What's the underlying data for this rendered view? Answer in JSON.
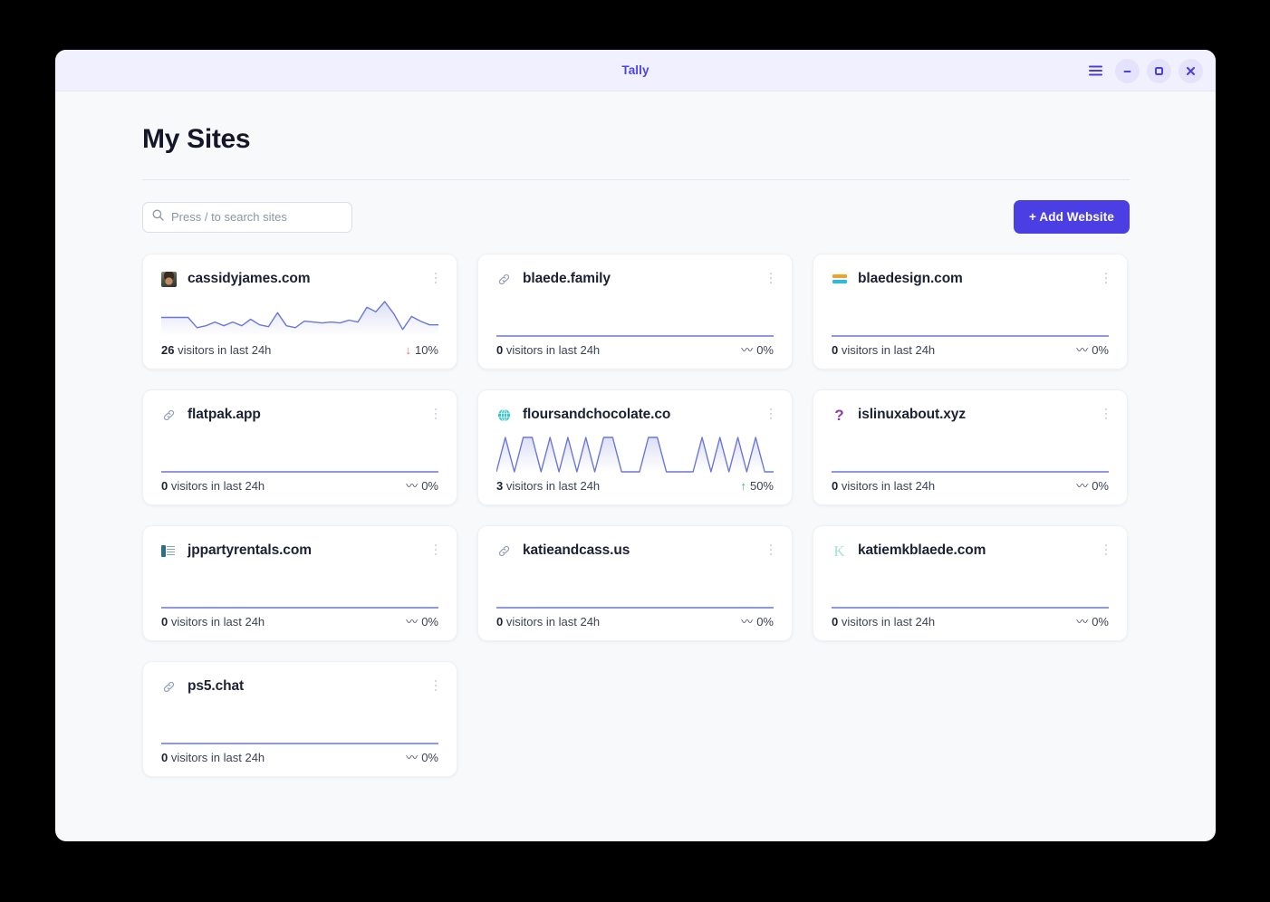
{
  "window": {
    "title": "Tally",
    "controls": [
      {
        "name": "menu-button",
        "label": "☰"
      },
      {
        "name": "minimize-button",
        "label": "–"
      },
      {
        "name": "maximize-button",
        "label": "□"
      },
      {
        "name": "close-button",
        "label": "✕"
      }
    ]
  },
  "page": {
    "title": "My Sites"
  },
  "search": {
    "placeholder": "Press / to search sites",
    "value": "",
    "icon": "search-icon"
  },
  "toolbar": {
    "add_website_label": "+ Add Website"
  },
  "colors": {
    "accent": "#4b3fe4",
    "titlebar_bg": "#f1f0fe",
    "page_bg": "#f7f9fb",
    "card_bg": "#ffffff",
    "spark_line": "#6b77d6",
    "trend_up": "#22b573",
    "trend_down": "#ef6a5e",
    "trend_flat": "#3b4354"
  },
  "sites": [
    {
      "domain": "cassidyjames.com",
      "favicon": "photo-favicon",
      "visitors": "26",
      "visitors_suffix": " visitors in last 24h",
      "trend_direction": "down",
      "trend_glyph": "↓",
      "trend_value": "10%",
      "menu_icon": "kebab-menu-icon",
      "sparkline": [
        40,
        40,
        40,
        40,
        18,
        22,
        30,
        22,
        30,
        22,
        36,
        24,
        20,
        50,
        22,
        18,
        32,
        30,
        28,
        30,
        28,
        34,
        30,
        62,
        52,
        74,
        48,
        14,
        42,
        32,
        24,
        24
      ]
    },
    {
      "domain": "blaede.family",
      "favicon": "link-icon",
      "visitors": "0",
      "visitors_suffix": " visitors in last 24h",
      "trend_direction": "flat",
      "trend_glyph": "〰",
      "trend_value": "0%",
      "menu_icon": "kebab-menu-icon",
      "sparkline": [
        0,
        0,
        0,
        0,
        0,
        0,
        0,
        0,
        0,
        0,
        0,
        0,
        0,
        0,
        0,
        0,
        0,
        0,
        0,
        0,
        0,
        0,
        0,
        0,
        0,
        0,
        0,
        0,
        0,
        0,
        0,
        0
      ]
    },
    {
      "domain": "blaedesign.com",
      "favicon": "bars-favicon",
      "visitors": "0",
      "visitors_suffix": " visitors in last 24h",
      "trend_direction": "flat",
      "trend_glyph": "〰",
      "trend_value": "0%",
      "menu_icon": "kebab-menu-icon",
      "sparkline": [
        0,
        0,
        0,
        0,
        0,
        0,
        0,
        0,
        0,
        0,
        0,
        0,
        0,
        0,
        0,
        0,
        0,
        0,
        0,
        0,
        0,
        0,
        0,
        0,
        0,
        0,
        0,
        0,
        0,
        0,
        0,
        0
      ]
    },
    {
      "domain": "flatpak.app",
      "favicon": "link-icon",
      "visitors": "0",
      "visitors_suffix": " visitors in last 24h",
      "trend_direction": "flat",
      "trend_glyph": "〰",
      "trend_value": "0%",
      "menu_icon": "kebab-menu-icon",
      "sparkline": [
        0,
        0,
        0,
        0,
        0,
        0,
        0,
        0,
        0,
        0,
        0,
        0,
        0,
        0,
        0,
        0,
        0,
        0,
        0,
        0,
        0,
        0,
        0,
        0,
        0,
        0,
        0,
        0,
        0,
        0,
        0,
        0
      ]
    },
    {
      "domain": "floursandchocolate.co",
      "favicon": "globe-icon",
      "visitors": "3",
      "visitors_suffix": " visitors in last 24h",
      "trend_direction": "up",
      "trend_glyph": "↑",
      "trend_value": "50%",
      "menu_icon": "kebab-menu-icon",
      "sparkline": [
        0,
        66,
        0,
        66,
        66,
        0,
        66,
        0,
        66,
        0,
        66,
        0,
        66,
        66,
        0,
        0,
        0,
        66,
        66,
        0,
        0,
        0,
        0,
        66,
        0,
        66,
        0,
        66,
        0,
        66,
        0,
        0
      ]
    },
    {
      "domain": "islinuxabout.xyz",
      "favicon": "question-favicon",
      "visitors": "0",
      "visitors_suffix": " visitors in last 24h",
      "trend_direction": "flat",
      "trend_glyph": "〰",
      "trend_value": "0%",
      "menu_icon": "kebab-menu-icon",
      "sparkline": [
        0,
        0,
        0,
        0,
        0,
        0,
        0,
        0,
        0,
        0,
        0,
        0,
        0,
        0,
        0,
        0,
        0,
        0,
        0,
        0,
        0,
        0,
        0,
        0,
        0,
        0,
        0,
        0,
        0,
        0,
        0,
        0
      ]
    },
    {
      "domain": "jppartyrentals.com",
      "favicon": "jp-favicon",
      "visitors": "0",
      "visitors_suffix": " visitors in last 24h",
      "trend_direction": "flat",
      "trend_glyph": "〰",
      "trend_value": "0%",
      "menu_icon": "kebab-menu-icon",
      "sparkline": [
        0,
        0,
        0,
        0,
        0,
        0,
        0,
        0,
        0,
        0,
        0,
        0,
        0,
        0,
        0,
        0,
        0,
        0,
        0,
        0,
        0,
        0,
        0,
        0,
        0,
        0,
        0,
        0,
        0,
        0,
        0,
        0
      ]
    },
    {
      "domain": "katieandcass.us",
      "favicon": "link-icon",
      "visitors": "0",
      "visitors_suffix": " visitors in last 24h",
      "trend_direction": "flat",
      "trend_glyph": "〰",
      "trend_value": "0%",
      "menu_icon": "kebab-menu-icon",
      "sparkline": [
        0,
        0,
        0,
        0,
        0,
        0,
        0,
        0,
        0,
        0,
        0,
        0,
        0,
        0,
        0,
        0,
        0,
        0,
        0,
        0,
        0,
        0,
        0,
        0,
        0,
        0,
        0,
        0,
        0,
        0,
        0,
        0
      ]
    },
    {
      "domain": "katiemkblaede.com",
      "favicon": "letter-k-favicon",
      "visitors": "0",
      "visitors_suffix": " visitors in last 24h",
      "trend_direction": "flat",
      "trend_glyph": "〰",
      "trend_value": "0%",
      "menu_icon": "kebab-menu-icon",
      "sparkline": [
        0,
        0,
        0,
        0,
        0,
        0,
        0,
        0,
        0,
        0,
        0,
        0,
        0,
        0,
        0,
        0,
        0,
        0,
        0,
        0,
        0,
        0,
        0,
        0,
        0,
        0,
        0,
        0,
        0,
        0,
        0,
        0
      ]
    },
    {
      "domain": "ps5.chat",
      "favicon": "link-icon",
      "visitors": "0",
      "visitors_suffix": " visitors in last 24h",
      "trend_direction": "flat",
      "trend_glyph": "〰",
      "trend_value": "0%",
      "menu_icon": "kebab-menu-icon",
      "sparkline": [
        0,
        0,
        0,
        0,
        0,
        0,
        0,
        0,
        0,
        0,
        0,
        0,
        0,
        0,
        0,
        0,
        0,
        0,
        0,
        0,
        0,
        0,
        0,
        0,
        0,
        0,
        0,
        0,
        0,
        0,
        0,
        0
      ]
    }
  ]
}
